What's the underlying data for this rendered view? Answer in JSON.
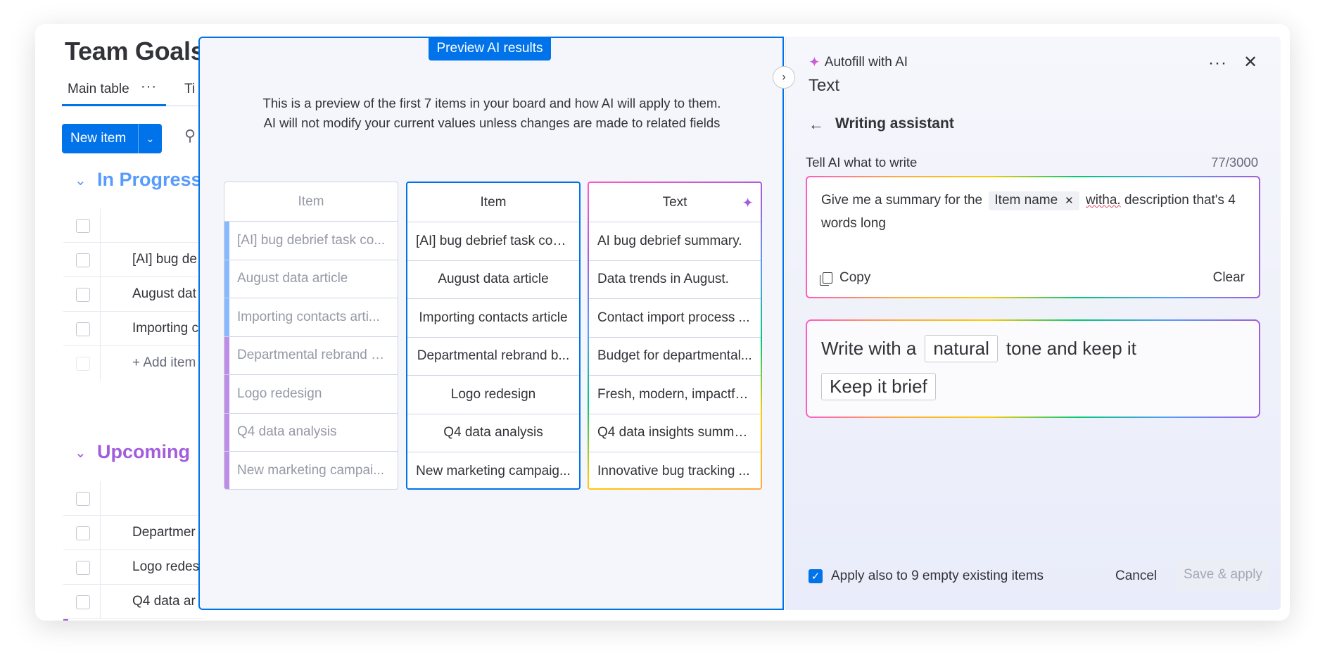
{
  "board": {
    "title": "Team Goals",
    "tabs": [
      {
        "label": "Main table"
      },
      {
        "label": "Ti"
      }
    ],
    "new_item_label": "New item",
    "groups": [
      {
        "title": "In Progress",
        "color": "#579bfc",
        "rows": [
          "[AI] bug de",
          "August dat",
          "Importing c"
        ],
        "add_item": "+ Add item"
      },
      {
        "title": "Upcoming",
        "color": "#a25ddc",
        "rows": [
          "Departmer",
          "Logo redes",
          "Q4 data ar"
        ]
      }
    ]
  },
  "preview": {
    "badge": "Preview AI results",
    "description_line1": "This is a preview of the first 7 items in your board and how AI will apply to them.",
    "description_line2": "AI will not modify your current values unless changes are made to related fields",
    "columns": [
      {
        "header": "Item",
        "cells": [
          "[AI] bug debrief task co...",
          "August data article",
          "Importing contacts arti...",
          "Departmental rebrand b...",
          "Logo redesign",
          "Q4 data analysis",
          "New marketing campai..."
        ]
      },
      {
        "header": "Item",
        "cells": [
          "[AI] bug debrief task con...",
          "August data article",
          "Importing contacts article",
          "Departmental rebrand b...",
          "Logo redesign",
          "Q4 data analysis",
          "New marketing campaig..."
        ]
      },
      {
        "header": "Text",
        "cells": [
          "AI bug debrief summary.",
          "Data trends in August.",
          "Contact import process ...",
          "Budget for departmental...",
          "Fresh, modern, impactful...",
          "Q4 data insights summa...",
          "Innovative bug tracking ..."
        ]
      }
    ],
    "stripe_colors": [
      "#579bfc",
      "#579bfc",
      "#579bfc",
      "#a25ddc",
      "#a25ddc",
      "#a25ddc",
      "#a25ddc"
    ]
  },
  "panel": {
    "autofill_label": "Autofill with AI",
    "column_type": "Text",
    "section_title": "Writing assistant",
    "tell_label": "Tell AI what to write",
    "char_count": "77/3000",
    "prompt_before": "Give me a summary for the",
    "prompt_chip": "Item name",
    "prompt_misspelled": "witha.",
    "prompt_after": "description that's 4 words long",
    "copy_label": "Copy",
    "clear_label": "Clear",
    "tone_prefix": "Write with a",
    "tone_value": "natural",
    "tone_suffix": "tone and keep it",
    "length_value": "Keep it brief",
    "apply_label": "Apply also to 9 empty existing items",
    "cancel_label": "Cancel",
    "save_label": "Save & apply"
  },
  "colors": {
    "accent": "#0073ea",
    "in_progress": "#579bfc",
    "upcoming": "#a25ddc"
  }
}
